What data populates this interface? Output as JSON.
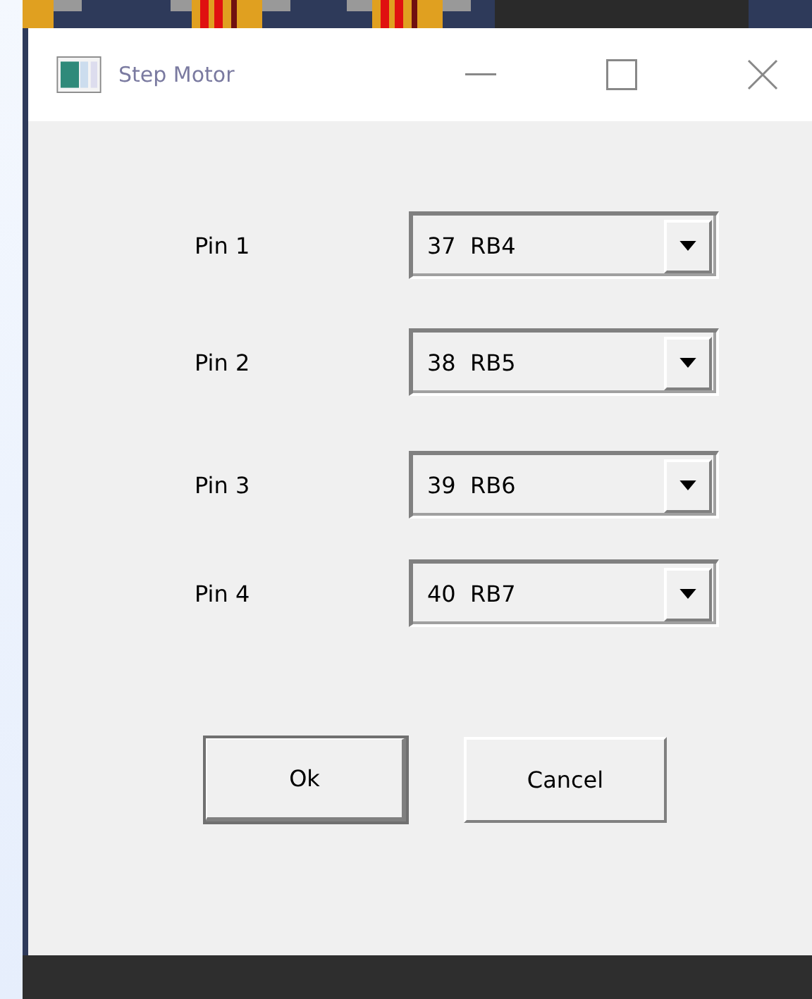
{
  "window": {
    "title": "Step Motor"
  },
  "pins": [
    {
      "label": "Pin 1",
      "value": "37  RB4"
    },
    {
      "label": "Pin 2",
      "value": "38  RB5"
    },
    {
      "label": "Pin 3",
      "value": "39  RB6"
    },
    {
      "label": "Pin 4",
      "value": "40  RB7"
    }
  ],
  "buttons": [
    {
      "label": "Ok",
      "default": true
    },
    {
      "label": "Cancel",
      "default": false
    }
  ]
}
